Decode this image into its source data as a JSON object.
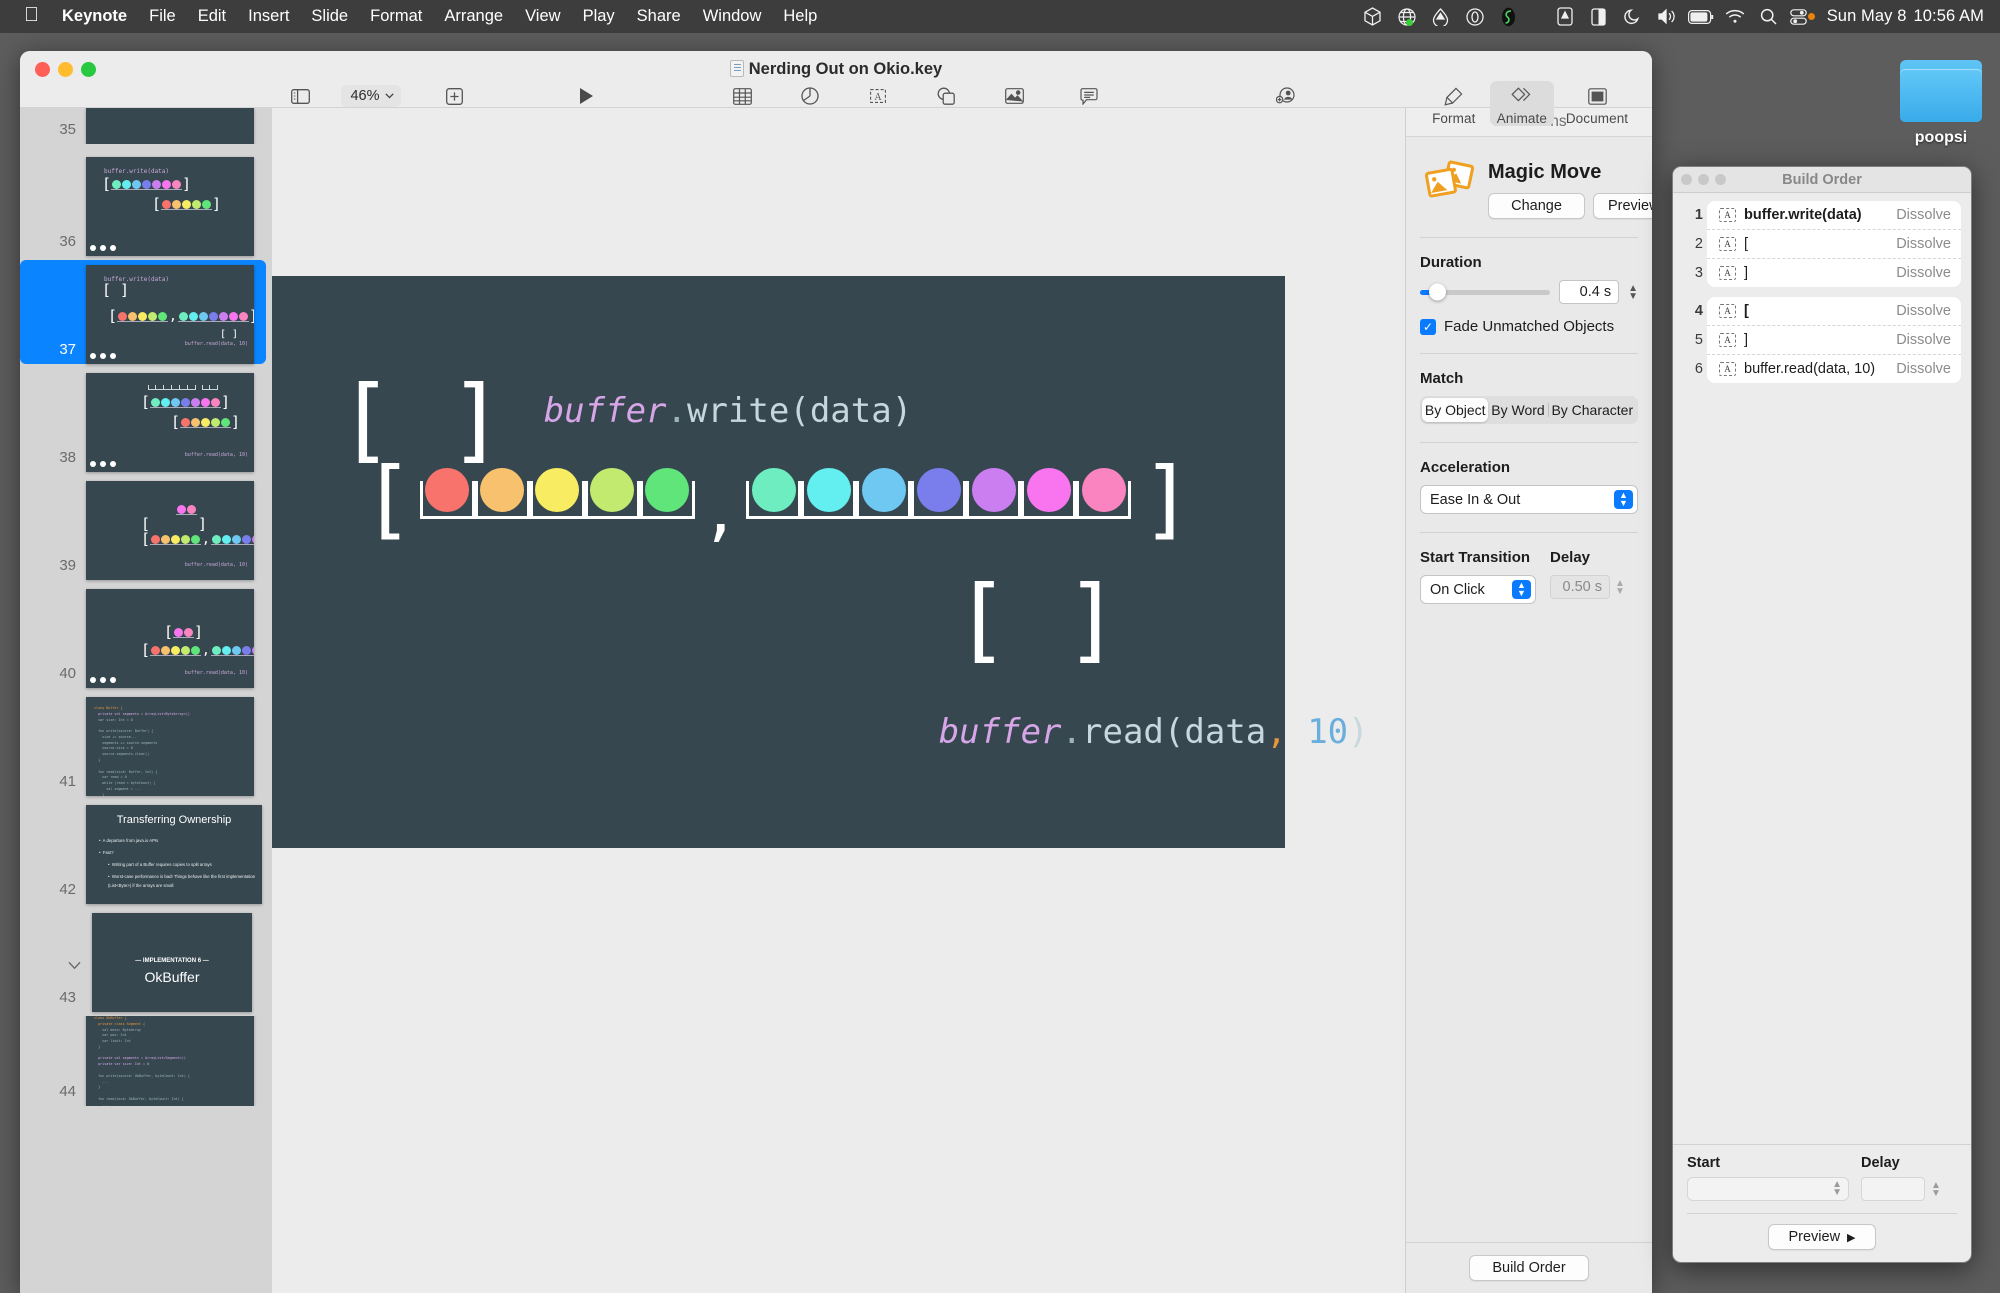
{
  "menubar": {
    "apple_icon": "apple-icon",
    "items": [
      "Keynote",
      "File",
      "Edit",
      "Insert",
      "Slide",
      "Format",
      "Arrange",
      "View",
      "Play",
      "Share",
      "Window",
      "Help"
    ],
    "status_icons": [
      "package-icon",
      "globe-icon",
      "droplet-icon",
      "circle-zero-icon",
      "shell-script-icon",
      "dropbox-icon",
      "contrast-icon",
      "moon-icon",
      "volume-icon",
      "battery-icon",
      "wifi-icon",
      "search-icon",
      "control-center-icon"
    ],
    "clock": "Sun May 8",
    "time": "10:56 AM"
  },
  "desktop": {
    "folder_label": "poopsi"
  },
  "window": {
    "title": "Nerding Out on Okio.key"
  },
  "toolbar": {
    "view_label": "View",
    "zoom_value": "46%",
    "zoom_label": "Zoom",
    "add_slide_label": "Add Slide",
    "play_label": "Play",
    "table_label": "Table",
    "chart_label": "Chart",
    "text_label": "Text",
    "shape_label": "Shape",
    "media_label": "Media",
    "comment_label": "Comment",
    "collaborate_label": "Collaborate",
    "format_label": "Format",
    "animate_label": "Animate",
    "document_label": "Document"
  },
  "navigator": {
    "slides": [
      {
        "number": "35"
      },
      {
        "number": "36"
      },
      {
        "number": "37"
      },
      {
        "number": "38"
      },
      {
        "number": "39"
      },
      {
        "number": "40"
      },
      {
        "number": "41"
      },
      {
        "number": "42",
        "title": "Transferring Ownership",
        "bullets": [
          "A departure from java.io APIs",
          "Fast?",
          "Writing part of a Buffer requires copies to split arrays",
          "Worst-case performance is bad! Things behave like the first implementation (List<Byte>) if the arrays are small"
        ]
      },
      {
        "number": "43",
        "eyebrow": "— IMPLEMENTATION 6 —",
        "title": "OkBuffer"
      },
      {
        "number": "44"
      }
    ],
    "selected": "37"
  },
  "slide": {
    "write_call": {
      "receiver": "buffer",
      "dot": ".",
      "method": "write(data)"
    },
    "read_call": {
      "receiver": "buffer",
      "dot": ".",
      "method": "read(data",
      "comma": ",",
      "arg": " 10",
      "close": ")"
    },
    "array_a": [
      "#f8736b",
      "#f8c16e",
      "#f8ec62",
      "#c2ea6f",
      "#5fe57a"
    ],
    "array_b": [
      "#6eeec0",
      "#63efef",
      "#6ec8f2",
      "#7a7eec",
      "#cb7ef0",
      "#f875ef",
      "#fa84c0"
    ],
    "separator": ",",
    "empty_top": "[ ]",
    "empty_bottom": "[ ]"
  },
  "inspector": {
    "header": "Transitions",
    "effect_name": "Magic Move",
    "change_button": "Change",
    "preview_button": "Preview",
    "preview_glyph": "▶",
    "duration_label": "Duration",
    "duration_value": "0.4 s",
    "fade_label": "Fade Unmatched Objects",
    "fade_checked": true,
    "match_label": "Match",
    "match_options": [
      "By Object",
      "By Word",
      "By Character"
    ],
    "match_selected": "By Object",
    "acceleration_label": "Acceleration",
    "acceleration_value": "Ease In & Out",
    "start_transition_label": "Start Transition",
    "start_transition_value": "On Click",
    "delay_label": "Delay",
    "delay_value": "0.50 s",
    "build_order_button": "Build Order"
  },
  "build_order": {
    "title": "Build Order",
    "groups": [
      {
        "items": [
          {
            "index": "1",
            "name": "buffer.write(data)",
            "effect": "Dissolve",
            "bold": true
          },
          {
            "index": "2",
            "name": "[",
            "effect": "Dissolve",
            "bold": false
          },
          {
            "index": "3",
            "name": "]",
            "effect": "Dissolve",
            "bold": false
          }
        ]
      },
      {
        "items": [
          {
            "index": "4",
            "name": "[",
            "effect": "Dissolve",
            "bold": true
          },
          {
            "index": "5",
            "name": "]",
            "effect": "Dissolve",
            "bold": false
          },
          {
            "index": "6",
            "name": "buffer.read(data, 10)",
            "effect": "Dissolve",
            "bold": false
          }
        ]
      }
    ],
    "start_label": "Start",
    "delay_label": "Delay",
    "preview_button": "Preview",
    "preview_glyph": "▶"
  }
}
